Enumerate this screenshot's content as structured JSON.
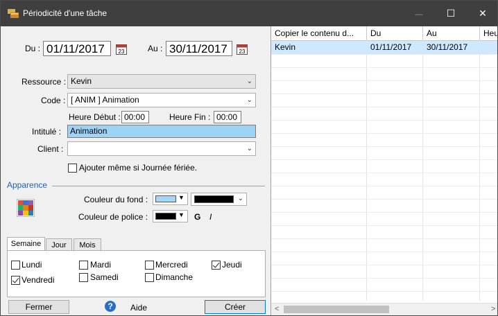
{
  "window": {
    "title": "Périodicité d'une tâche",
    "controls": {
      "minimize": "—",
      "maximize": "☐",
      "close": "✕"
    }
  },
  "form": {
    "du_label": "Du :",
    "du_value": "01/11/2017",
    "au_label": "Au :",
    "au_value": "30/11/2017",
    "calendar_day": "23",
    "ressource_label": "Ressource :",
    "ressource_value": "Kevin",
    "code_label": "Code :",
    "code_value": "[ ANIM ] Animation",
    "heure_debut_label": "Heure Début :",
    "heure_debut_value": "00:00",
    "heure_fin_label": "Heure Fin :",
    "heure_fin_value": "00:00",
    "intitule_label": "Intitulé :",
    "intitule_value": "Animation",
    "client_label": "Client :",
    "client_value": "",
    "ferie_label": "Ajouter même si Journée fériée.",
    "ferie_checked": false
  },
  "apparence": {
    "section_title": "Apparence",
    "fond_label": "Couleur du fond :",
    "fond_color": "#a6d6f5",
    "fond_combo_color": "#000000",
    "police_label": "Couleur de police :",
    "police_color": "#000000",
    "bold_label": "G",
    "italic_label": "I"
  },
  "tabs": [
    {
      "label": "Semaine",
      "active": true
    },
    {
      "label": "Jour",
      "active": false
    },
    {
      "label": "Mois",
      "active": false
    }
  ],
  "days": [
    {
      "label": "Lundi",
      "checked": false
    },
    {
      "label": "Mardi",
      "checked": false
    },
    {
      "label": "Mercredi",
      "checked": false
    },
    {
      "label": "Jeudi",
      "checked": true
    },
    {
      "label": "Vendredi",
      "checked": true
    },
    {
      "label": "Samedi",
      "checked": false
    },
    {
      "label": "Dimanche",
      "checked": false
    }
  ],
  "footer": {
    "fermer": "Fermer",
    "help_glyph": "?",
    "aide": "Aide",
    "creer": "Créer"
  },
  "grid": {
    "columns": [
      "Copier le contenu d...",
      "Du",
      "Au",
      "Heu"
    ],
    "rows": [
      [
        "Kevin",
        "01/11/2017",
        "30/11/2017",
        ""
      ]
    ],
    "selected_row": 0,
    "scroll_left_arrow": "<",
    "scroll_right_arrow": ">"
  },
  "colors": {
    "title_bar": "#3f3f3f",
    "accent": "#1f5fbf",
    "selection": "#cde8ff",
    "intitule_highlight": "#9dd3f7"
  }
}
